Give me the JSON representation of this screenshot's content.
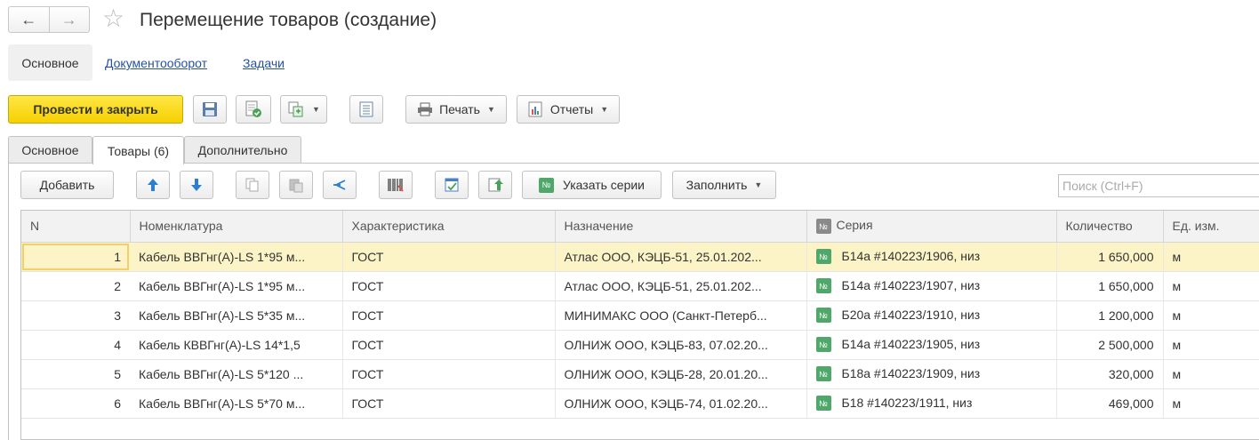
{
  "window": {
    "back_glyph": "←",
    "forward_glyph": "→",
    "star_glyph": "☆",
    "title": "Перемещение товаров (создание)"
  },
  "topnav": {
    "active": "Основное",
    "links": [
      "Документооборот",
      "Задачи"
    ]
  },
  "toolbar": {
    "post_close": "Провести и закрыть",
    "print": "Печать",
    "reports": "Отчеты"
  },
  "tabs": [
    "Основное",
    "Товары (6)",
    "Дополнительно"
  ],
  "table_toolbar": {
    "add": "Добавить",
    "series": "Указать серии",
    "fill": "Заполнить",
    "search_placeholder": "Поиск (Ctrl+F)"
  },
  "badge_glyph": "№",
  "table": {
    "columns": [
      "N",
      "Номенклатура",
      "Характеристика",
      "Назначение",
      "Серия",
      "Количество",
      "Ед. изм."
    ],
    "rows": [
      {
        "n": "1",
        "item": "Кабель ВВГнг(А)-LS 1*95 м...",
        "char": "ГОСТ",
        "dest": "Атлас ООО, КЭЦБ-51, 25.01.202...",
        "series": "Б14а #140223/1906, низ",
        "qty": "1 650,000",
        "unit": "м"
      },
      {
        "n": "2",
        "item": "Кабель ВВГнг(А)-LS 1*95 м...",
        "char": "ГОСТ",
        "dest": "Атлас ООО, КЭЦБ-51, 25.01.202...",
        "series": "Б14а #140223/1907, низ",
        "qty": "1 650,000",
        "unit": "м"
      },
      {
        "n": "3",
        "item": "Кабель ВВГнг(А)-LS 5*35 м...",
        "char": "ГОСТ",
        "dest": "МИНИМАКС ООО (Санкт-Петерб...",
        "series": "Б20а #140223/1910, низ",
        "qty": "1 200,000",
        "unit": "м"
      },
      {
        "n": "4",
        "item": "Кабель КВВГнг(А)-LS 14*1,5",
        "char": "ГОСТ",
        "dest": "ОЛНИЖ ООО, КЭЦБ-83, 07.02.20...",
        "series": "Б14а #140223/1905, низ",
        "qty": "2 500,000",
        "unit": "м"
      },
      {
        "n": "5",
        "item": "Кабель ВВГнг(А)-LS 5*120 ...",
        "char": "ГОСТ",
        "dest": "ОЛНИЖ ООО, КЭЦБ-28, 20.01.20...",
        "series": "Б18а #140223/1909, низ",
        "qty": "320,000",
        "unit": "м"
      },
      {
        "n": "6",
        "item": "Кабель ВВГнг(А)-LS 5*70 м...",
        "char": "ГОСТ",
        "dest": "ОЛНИЖ ООО, КЭЦБ-74, 01.02.20...",
        "series": "Б18 #140223/1911, низ",
        "qty": "469,000",
        "unit": "м"
      }
    ]
  },
  "colors": {
    "primary_button": "#f5d000",
    "selected_row": "#fcf3c6",
    "series_badge": "#4fa86a",
    "link": "#2650a0"
  }
}
